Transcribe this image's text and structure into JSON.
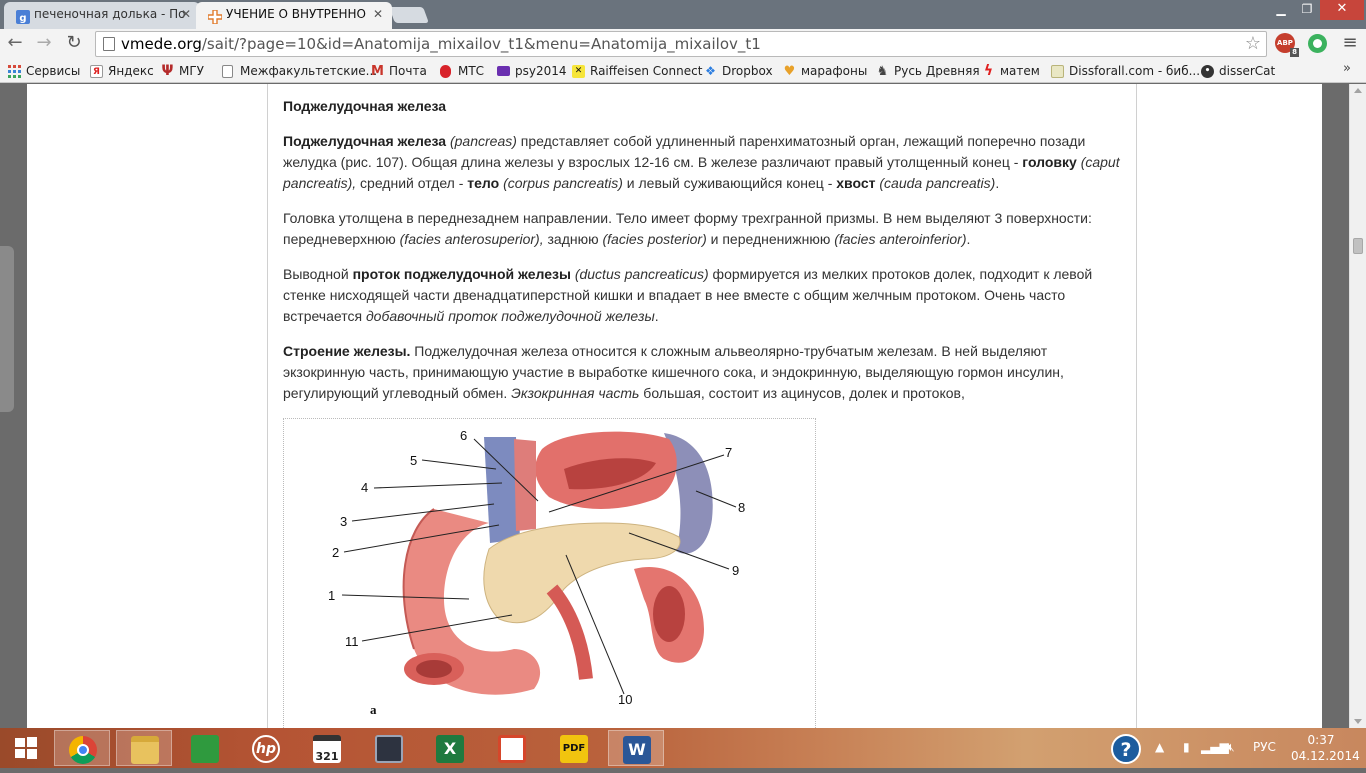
{
  "browser": {
    "tabs": [
      {
        "title": "печеночная долька - По",
        "active": false
      },
      {
        "title": "УЧЕНИЕ О ВНУТРЕННО",
        "active": true
      }
    ],
    "url_host": "vmede.org",
    "url_path": "/sait/?page=10&id=Anatomija_mixailov_t1&menu=Anatomija_mixailov_t1",
    "extension_badge": "8",
    "abp_label": "ABP",
    "bookmarks": [
      {
        "label": "Сервисы",
        "icon": "apps-grid-icon"
      },
      {
        "label": "Яндекс",
        "icon": "yandex-icon"
      },
      {
        "label": "МГУ",
        "icon": "psi-icon"
      },
      {
        "label": "Межфакультетские...",
        "icon": "page-icon"
      },
      {
        "label": "Почта",
        "icon": "gmail-icon"
      },
      {
        "label": "МТС",
        "icon": "mts-icon"
      },
      {
        "label": "psy2014",
        "icon": "mail-icon"
      },
      {
        "label": "Raiffeisen Connect",
        "icon": "raiffeisen-icon"
      },
      {
        "label": "Dropbox",
        "icon": "dropbox-icon"
      },
      {
        "label": "марафоны",
        "icon": "heart-icon"
      },
      {
        "label": "Русь Древняя",
        "icon": "horse-icon"
      },
      {
        "label": "матем",
        "icon": "lightning-icon"
      },
      {
        "label": "Dissforall.com - биб...",
        "icon": "document-icon"
      },
      {
        "label": "disserCat",
        "icon": "dissercat-icon"
      }
    ],
    "bookmarks_more": "»"
  },
  "article": {
    "heading": "Поджелудочная железа",
    "p1": {
      "t1": "Поджелудочная железа",
      "t2": " (pancreas)",
      "t3": " представляет собой удлиненный паренхиматозный орган, лежащий поперечно позади желудка (рис. 107). Общая длина железы у взрослых 12-16 см. В железе различают правый утолщенный конец - ",
      "t4": "головку",
      "t5": " (caput pancreatis),",
      "t6": " средний отдел - ",
      "t7": "тело",
      "t8": " (corpus pancreatis)",
      "t9": " и левый суживающийся конец - ",
      "t10": "хвост",
      "t11": " (cauda pancreatis)",
      "t12": "."
    },
    "p2": {
      "t1": "Головка утолщена в переднезаднем направлении. Тело имеет форму трехгранной призмы. В нем выделяют 3 поверхности: передневерхнюю ",
      "t2": "(facies anterosuperior),",
      "t3": " заднюю ",
      "t4": "(facies posterior)",
      "t5": " и передненижнюю ",
      "t6": "(facies anteroinferior)",
      "t7": "."
    },
    "p3": {
      "t1": "Выводной ",
      "t2": "проток поджелудочной железы",
      "t3": " (ductus pancreaticus)",
      "t4": " формируется из мелких протоков долек, подходит к левой стенке нисходящей части двенадцатиперстной кишки и впадает в нее вместе с общим желчным протоком. Очень часто встречается ",
      "t5": "добавочный проток поджелудочной железы",
      "t6": "."
    },
    "p4": {
      "t1": "Строение железы.",
      "t2": " Поджелудочная железа относится к сложным альвеолярно-трубчатым железам. В ней выделяют экзокринную часть, принимающую участие в выработке кишечного сока, и эндокринную, выделяющую гормон инсулин, регулирующий углеводный обмен. ",
      "t3": "Экзокринная часть",
      "t4": " большая, состоит из ацинусов, долек и протоков,"
    },
    "figure": {
      "labels": [
        "1",
        "2",
        "3",
        "4",
        "5",
        "6",
        "7",
        "8",
        "9",
        "10",
        "11"
      ],
      "caption": "а"
    }
  },
  "taskbar": {
    "apps": [
      "chrome-icon",
      "file-explorer-icon",
      "store-icon",
      "hp-icon",
      "calendar-321-icon",
      "media-icon",
      "excel-icon",
      "slideshow-icon",
      "pdf-icon",
      "word-icon"
    ],
    "language": "РУС",
    "time": "0:37",
    "date": "04.12.2014"
  },
  "colors": {
    "accent_tab": "#f3f3f3",
    "taskbar_start": "#9a4a2a",
    "taskbar_end": "#d2a070",
    "organ_pink": "#e9807a",
    "pancreas": "#efd9ad"
  }
}
